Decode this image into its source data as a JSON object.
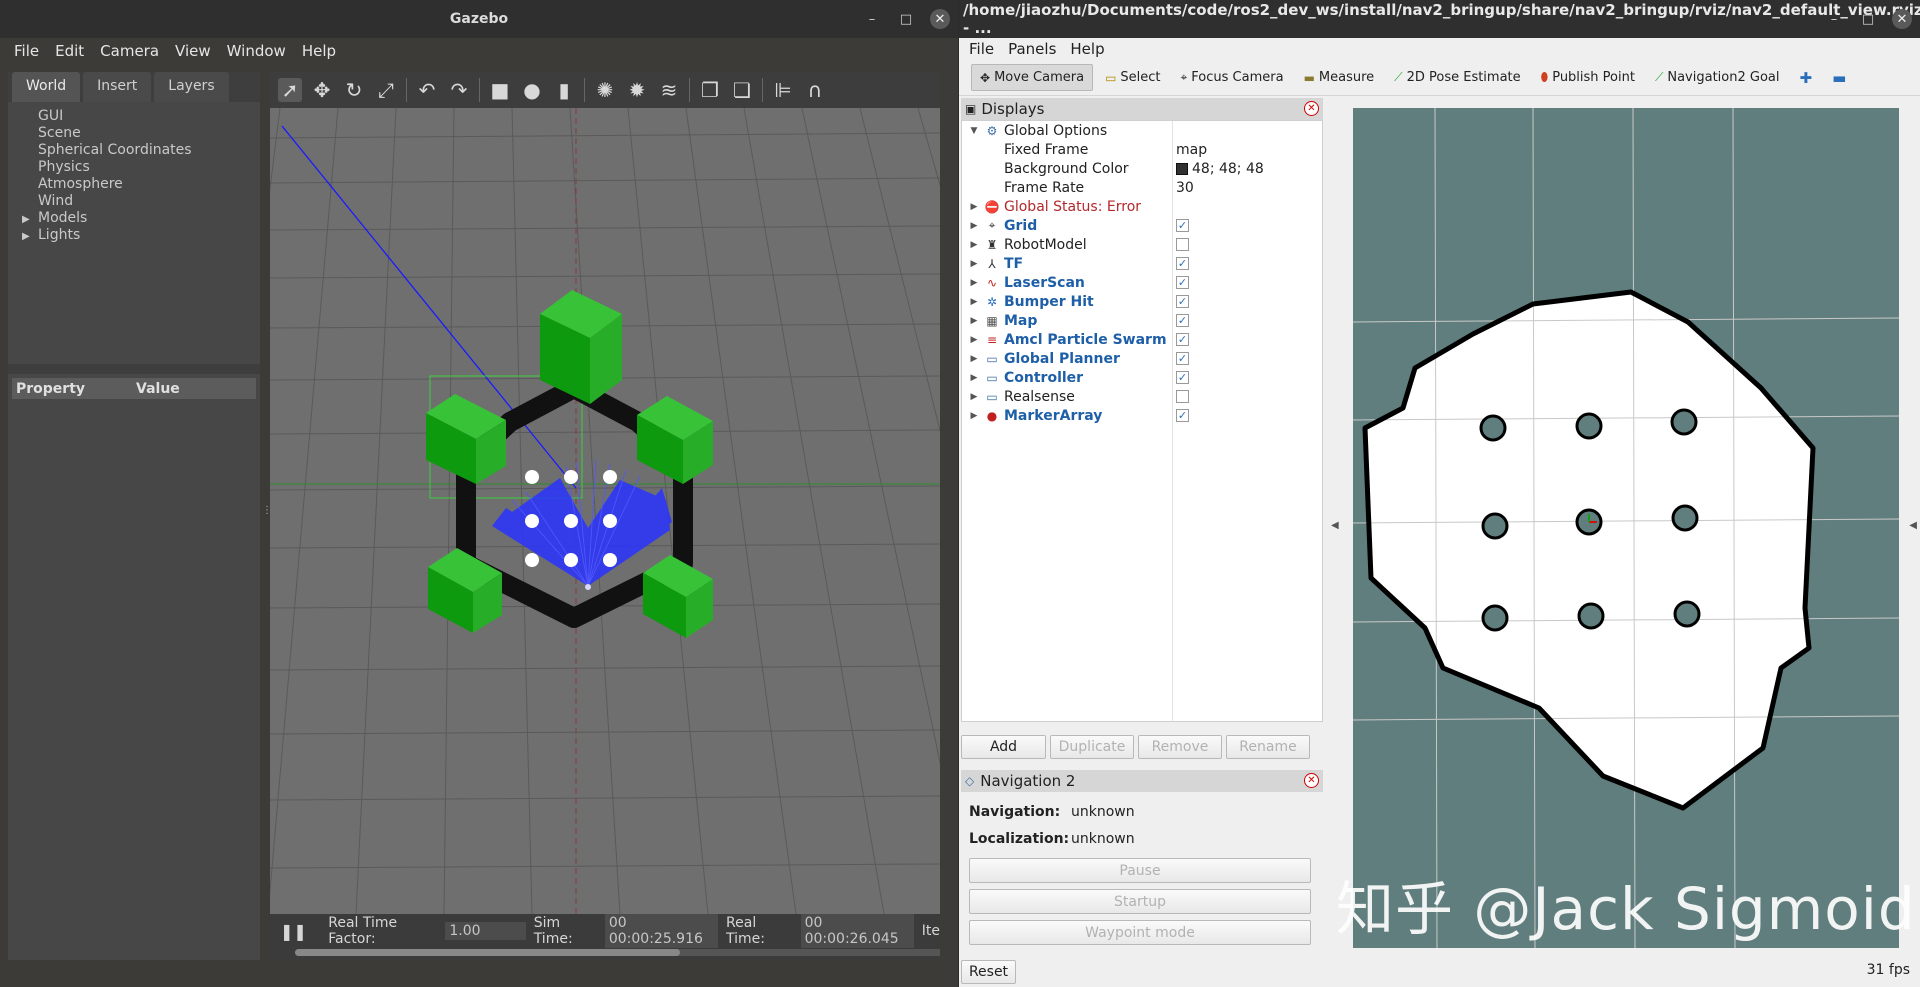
{
  "gazebo": {
    "title": "Gazebo",
    "window_buttons": [
      "–",
      "□",
      "✕"
    ],
    "menu": [
      "File",
      "Edit",
      "Camera",
      "View",
      "Window",
      "Help"
    ],
    "left_tabs": [
      "World",
      "Insert",
      "Layers"
    ],
    "world_tree": [
      {
        "label": "GUI",
        "expandable": false
      },
      {
        "label": "Scene",
        "expandable": false
      },
      {
        "label": "Spherical Coordinates",
        "expandable": false
      },
      {
        "label": "Physics",
        "expandable": false
      },
      {
        "label": "Atmosphere",
        "expandable": false
      },
      {
        "label": "Wind",
        "expandable": false
      },
      {
        "label": "Models",
        "expandable": true
      },
      {
        "label": "Lights",
        "expandable": true
      }
    ],
    "property_header": {
      "property": "Property",
      "value": "Value"
    },
    "status": {
      "pause_icon": "pause-icon",
      "rtf_label": "Real Time Factor:",
      "rtf_value": "1.00",
      "sim_label": "Sim Time:",
      "sim_value": "00 00:00:25.916",
      "real_label": "Real Time:",
      "real_value": "00 00:00:26.045",
      "iter_label": "Ite"
    }
  },
  "rviz": {
    "title": "/home/jiaozhu/Documents/code/ros2_dev_ws/install/nav2_bringup/share/nav2_bringup/rviz/nav2_default_view.rviz* - ...",
    "window_buttons": [
      "–",
      "□",
      "✕"
    ],
    "menu": [
      "File",
      "Panels",
      "Help"
    ],
    "tools": [
      {
        "label": "Move Camera",
        "icon": "move-camera-icon",
        "active": true
      },
      {
        "label": "Select",
        "icon": "select-icon",
        "active": false
      },
      {
        "label": "Focus Camera",
        "icon": "focus-camera-icon",
        "active": false
      },
      {
        "label": "Measure",
        "icon": "measure-icon",
        "active": false
      },
      {
        "label": "2D Pose Estimate",
        "icon": "pose-estimate-icon",
        "active": false
      },
      {
        "label": "Publish Point",
        "icon": "publish-point-icon",
        "active": false
      },
      {
        "label": "Navigation2 Goal",
        "icon": "nav-goal-icon",
        "active": false
      }
    ],
    "displays_title": "Displays",
    "global_options": {
      "label": "Global Options",
      "fixed_frame_label": "Fixed Frame",
      "fixed_frame": "map",
      "bg_label": "Background Color",
      "bg_value": "48; 48; 48",
      "frame_rate_label": "Frame Rate",
      "frame_rate": "30"
    },
    "global_status": "Global Status: Error",
    "displays": [
      {
        "name": "Grid",
        "checked": true,
        "enabled": true,
        "icon": "grid-icon"
      },
      {
        "name": "RobotModel",
        "checked": false,
        "enabled": false,
        "icon": "robot-icon"
      },
      {
        "name": "TF",
        "checked": true,
        "enabled": true,
        "icon": "tf-icon"
      },
      {
        "name": "LaserScan",
        "checked": true,
        "enabled": true,
        "icon": "laserscan-icon"
      },
      {
        "name": "Bumper Hit",
        "checked": true,
        "enabled": true,
        "icon": "bumper-icon"
      },
      {
        "name": "Map",
        "checked": true,
        "enabled": true,
        "icon": "map-icon"
      },
      {
        "name": "Amcl Particle Swarm",
        "checked": true,
        "enabled": true,
        "icon": "particle-icon"
      },
      {
        "name": "Global Planner",
        "checked": true,
        "enabled": true,
        "icon": "folder-icon"
      },
      {
        "name": "Controller",
        "checked": true,
        "enabled": true,
        "icon": "folder-icon"
      },
      {
        "name": "Realsense",
        "checked": false,
        "enabled": false,
        "icon": "folder-icon"
      },
      {
        "name": "MarkerArray",
        "checked": true,
        "enabled": true,
        "icon": "marker-icon"
      }
    ],
    "buttons": {
      "add": "Add",
      "duplicate": "Duplicate",
      "remove": "Remove",
      "rename": "Rename"
    },
    "nav2": {
      "title": "Navigation 2",
      "navigation_label": "Navigation:",
      "navigation_value": "unknown",
      "localization_label": "Localization:",
      "localization_value": "unknown",
      "pause": "Pause",
      "startup": "Startup",
      "waypoint": "Waypoint mode"
    },
    "reset": "Reset",
    "fps": "31 fps",
    "watermark": "知乎 @Jack Sigmoid",
    "colors": {
      "map_bg": "#617e7e",
      "free_space": "#ffffff",
      "obstacle": "#000000"
    }
  }
}
